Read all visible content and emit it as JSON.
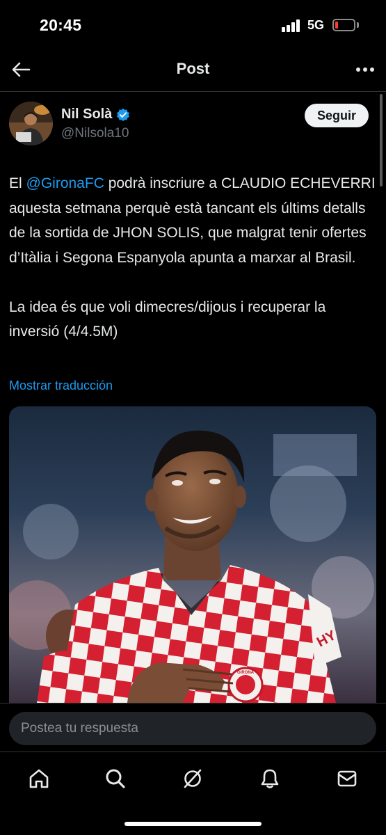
{
  "status_bar": {
    "time": "20:45",
    "network": "5G",
    "battery_color": "#ff3b30"
  },
  "header": {
    "title": "Post",
    "back_icon": "arrow-left-icon",
    "more_icon": "more-horizontal-icon"
  },
  "post": {
    "author_name": "Nil Solà",
    "author_handle": "@Nilsola10",
    "verified": true,
    "follow_label": "Seguir",
    "text_before_mention": "El ",
    "mention": "@GironaFC",
    "text_after_mention": " podrà inscriure a CLAUDIO ECHEVERRI aquesta setmana perquè està tancant els últims detalls de la sortida de JHON SOLIS, que malgrat tenir ofertes d’Itàlia i Segona Espanyola apunta a marxar al Brasil.\n\nLa idea és que voli dimecres/dijous i recuperar la inversió (4/4.5M)",
    "translate_label": "Mostrar traducción",
    "media_jersey_text": "HY",
    "media_crest_text": "GIRONA"
  },
  "reply": {
    "placeholder": "Postea tu respuesta"
  },
  "bottom_nav": {
    "items": [
      "home-icon",
      "search-icon",
      "grok-icon",
      "notifications-icon",
      "messages-icon"
    ]
  },
  "colors": {
    "background": "#000000",
    "accent": "#1d9bf0",
    "text": "#e7e9ea",
    "secondary_text": "#71767b"
  }
}
